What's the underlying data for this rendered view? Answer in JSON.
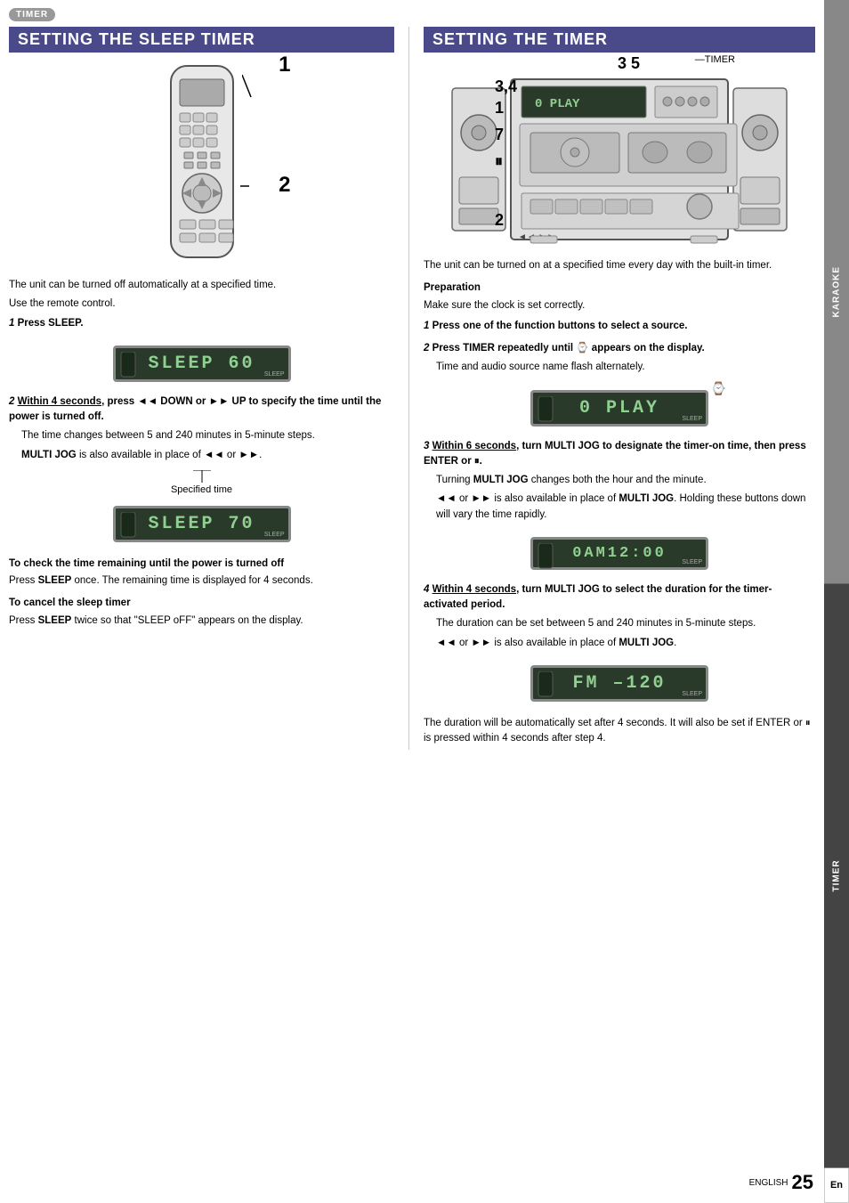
{
  "timer_badge": "TIMER",
  "left_section": {
    "title": "SETTING THE SLEEP TIMER",
    "intro": "The unit can be turned off automatically at a specified time.",
    "use_remote": "Use the remote control.",
    "steps": [
      {
        "num": "1",
        "title": "Press SLEEP.",
        "body": ""
      },
      {
        "num": "2",
        "title": "Within 4 seconds, press ◄◄ DOWN or ►► UP to specify the time until the power is turned off.",
        "underline_part": "Within 4 seconds",
        "body": "The time changes between 5 and 240 minutes in 5-minute steps.",
        "multi_jog_note": "MULTI JOG is also available in place of ◄◄ or ►►."
      }
    ],
    "specified_time_label": "Specified time",
    "display1_text": "SLEEP 60",
    "display2_text": "SLEEP 70",
    "check_heading": "To check the time remaining until the power is turned off",
    "check_body": "Press SLEEP once. The remaining time is displayed for 4 seconds.",
    "cancel_heading": "To cancel the sleep timer",
    "cancel_body": "Press SLEEP twice so that \"SLEEP oFF\" appears on the display."
  },
  "right_section": {
    "title": "SETTING THE TIMER",
    "intro": "The unit can be turned on at a specified time every day with the built-in timer.",
    "prep_heading": "Preparation",
    "prep_body": "Make sure the clock is set correctly.",
    "steps": [
      {
        "num": "1",
        "title": "Press one of the function buttons to select a source.",
        "body": ""
      },
      {
        "num": "2",
        "title": "Press TIMER repeatedly until ⌚ appears on the display.",
        "body": "Time and audio source name flash alternately."
      },
      {
        "num": "3",
        "title": "Within 6 seconds, turn MULTI JOG to designate the timer-on time, then press ENTER or ⏸.",
        "underline_part": "Within 6 seconds",
        "body1": "Turning MULTI JOG changes both the hour and the minute.",
        "body2": "◄◄ or ►► is also available in place of MULTI JOG. Holding these buttons down will vary the time rapidly."
      },
      {
        "num": "4",
        "title": "Within 4 seconds, turn MULTI JOG to select the duration for the timer-activated period.",
        "underline_part": "Within 4 seconds",
        "body1": "The duration can be set between 5 and 240 minutes in 5-minute steps.",
        "body2": "◄◄ or ►► is also available in place of MULTI JOG."
      }
    ],
    "display_play": "0  PLAY",
    "display_time": "0AM12:00",
    "display_fm": "FM  –120",
    "bottom_note": "The duration will be automatically set after 4 seconds. It will also be set if ENTER or ⏸ is pressed within 4 seconds after step 4.",
    "callout_nums": [
      "3,4",
      "1",
      "7",
      "⏸",
      "2",
      "3 5"
    ],
    "timer_label": "TIMER"
  },
  "page": {
    "lang": "En",
    "english_label": "ENGLISH",
    "number": "25"
  },
  "side_tabs": {
    "karaoke": "KARAOKE",
    "timer": "TIMER"
  }
}
